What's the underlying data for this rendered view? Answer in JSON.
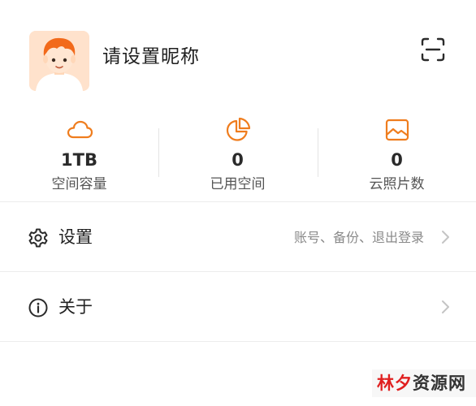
{
  "profile": {
    "nickname": "请设置昵称",
    "avatar_icon": "cartoon-avatar",
    "scan_icon": "scan-icon"
  },
  "colors": {
    "accent": "#ef7d1e",
    "avatar_bg": "#ffe2cc",
    "hair": "#f26a1b",
    "text_primary": "#222222",
    "text_secondary": "#8a8a8a",
    "divider": "#ececec",
    "watermark_red": "#e02020"
  },
  "stats": [
    {
      "icon": "cloud-icon",
      "value": "1TB",
      "label": "空间容量"
    },
    {
      "icon": "pie-chart-icon",
      "value": "0",
      "label": "已用空间"
    },
    {
      "icon": "image-icon",
      "value": "0",
      "label": "云照片数"
    }
  ],
  "menu": {
    "settings": {
      "icon": "gear-icon",
      "label": "设置",
      "subtitle": "账号、备份、退出登录"
    },
    "about": {
      "icon": "info-icon",
      "label": "关于"
    }
  },
  "watermark": {
    "part1": "林夕",
    "part2": "资源网"
  }
}
